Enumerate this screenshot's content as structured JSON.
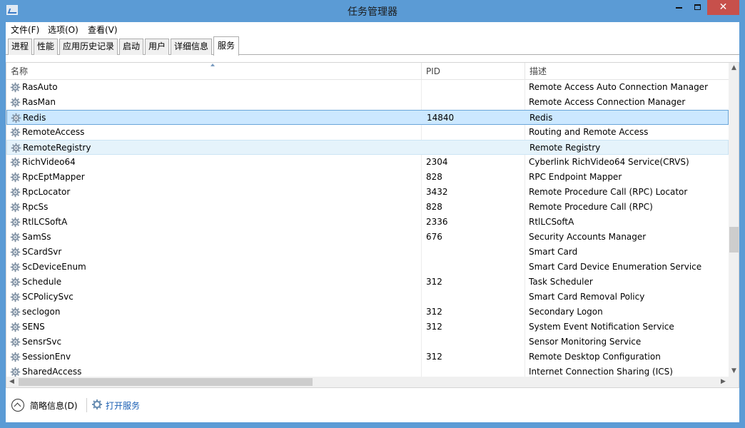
{
  "window": {
    "title": "任务管理器",
    "controls": {
      "minimize": "—",
      "maximize": "□",
      "close": "✕"
    }
  },
  "menu": {
    "file": "文件(F)",
    "options": "选项(O)",
    "view": "查看(V)"
  },
  "tabs": [
    {
      "label": "进程"
    },
    {
      "label": "性能"
    },
    {
      "label": "应用历史记录"
    },
    {
      "label": "启动"
    },
    {
      "label": "用户"
    },
    {
      "label": "详细信息"
    },
    {
      "label": "服务",
      "active": true
    }
  ],
  "table": {
    "headers": {
      "name": "名称",
      "pid": "PID",
      "description": "描述"
    },
    "sort": {
      "column": "name",
      "direction": "ascending"
    },
    "rows": [
      {
        "name": "RasAuto",
        "pid": "",
        "description": "Remote Access Auto Connection Manager"
      },
      {
        "name": "RasMan",
        "pid": "",
        "description": "Remote Access Connection Manager"
      },
      {
        "name": "Redis",
        "pid": "14840",
        "description": "Redis",
        "state": "selected"
      },
      {
        "name": "RemoteAccess",
        "pid": "",
        "description": "Routing and Remote Access"
      },
      {
        "name": "RemoteRegistry",
        "pid": "",
        "description": "Remote Registry",
        "state": "hover"
      },
      {
        "name": "RichVideo64",
        "pid": "2304",
        "description": "Cyberlink RichVideo64 Service(CRVS)"
      },
      {
        "name": "RpcEptMapper",
        "pid": "828",
        "description": "RPC Endpoint Mapper"
      },
      {
        "name": "RpcLocator",
        "pid": "3432",
        "description": "Remote Procedure Call (RPC) Locator"
      },
      {
        "name": "RpcSs",
        "pid": "828",
        "description": "Remote Procedure Call (RPC)"
      },
      {
        "name": "RtlLCSoftA",
        "pid": "2336",
        "description": "RtlLCSoftA"
      },
      {
        "name": "SamSs",
        "pid": "676",
        "description": "Security Accounts Manager"
      },
      {
        "name": "SCardSvr",
        "pid": "",
        "description": "Smart Card"
      },
      {
        "name": "ScDeviceEnum",
        "pid": "",
        "description": "Smart Card Device Enumeration Service"
      },
      {
        "name": "Schedule",
        "pid": "312",
        "description": "Task Scheduler"
      },
      {
        "name": "SCPolicySvc",
        "pid": "",
        "description": "Smart Card Removal Policy"
      },
      {
        "name": "seclogon",
        "pid": "312",
        "description": "Secondary Logon"
      },
      {
        "name": "SENS",
        "pid": "312",
        "description": "System Event Notification Service"
      },
      {
        "name": "SensrSvc",
        "pid": "",
        "description": "Sensor Monitoring Service"
      },
      {
        "name": "SessionEnv",
        "pid": "312",
        "description": "Remote Desktop Configuration"
      },
      {
        "name": "SharedAccess",
        "pid": "",
        "description": "Internet Connection Sharing (ICS)"
      }
    ],
    "icons": {
      "row": "gear-icon",
      "sort": "sort-up-icon"
    }
  },
  "footer": {
    "fewer_details": "简略信息(D)",
    "open_services": "打开服务"
  },
  "colors": {
    "titlebar": "#5b9bd5",
    "close_button": "#c7504b",
    "selection": "#cce8ff",
    "hover": "#e5f3fb",
    "link": "#1a5fb4"
  }
}
